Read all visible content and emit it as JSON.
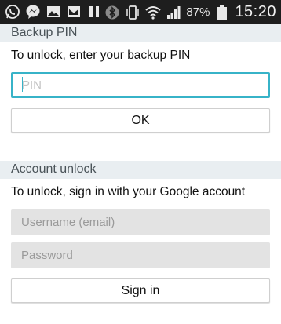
{
  "status_bar": {
    "left_icons": [
      "whatsapp-icon",
      "messenger-icon",
      "gallery-icon",
      "email-icon",
      "pause-icon"
    ],
    "right_icons": [
      "bluetooth-icon",
      "vibrate-icon",
      "wifi-icon",
      "signal-icon",
      "battery-icon"
    ],
    "battery_percent": "87%",
    "time": "15:20"
  },
  "backup_pin": {
    "header": "Backup PIN",
    "description": "To unlock, enter your backup PIN",
    "pin_placeholder": "PIN",
    "ok_label": "OK"
  },
  "account_unlock": {
    "header": "Account unlock",
    "description": "To unlock, sign in with your Google account",
    "username_placeholder": "Username (email)",
    "password_placeholder": "Password",
    "sign_in_label": "Sign in"
  },
  "colors": {
    "accent": "#37b3c8",
    "header_bg": "#e9eef1",
    "status_bar_bg": "#1e1e1e"
  }
}
